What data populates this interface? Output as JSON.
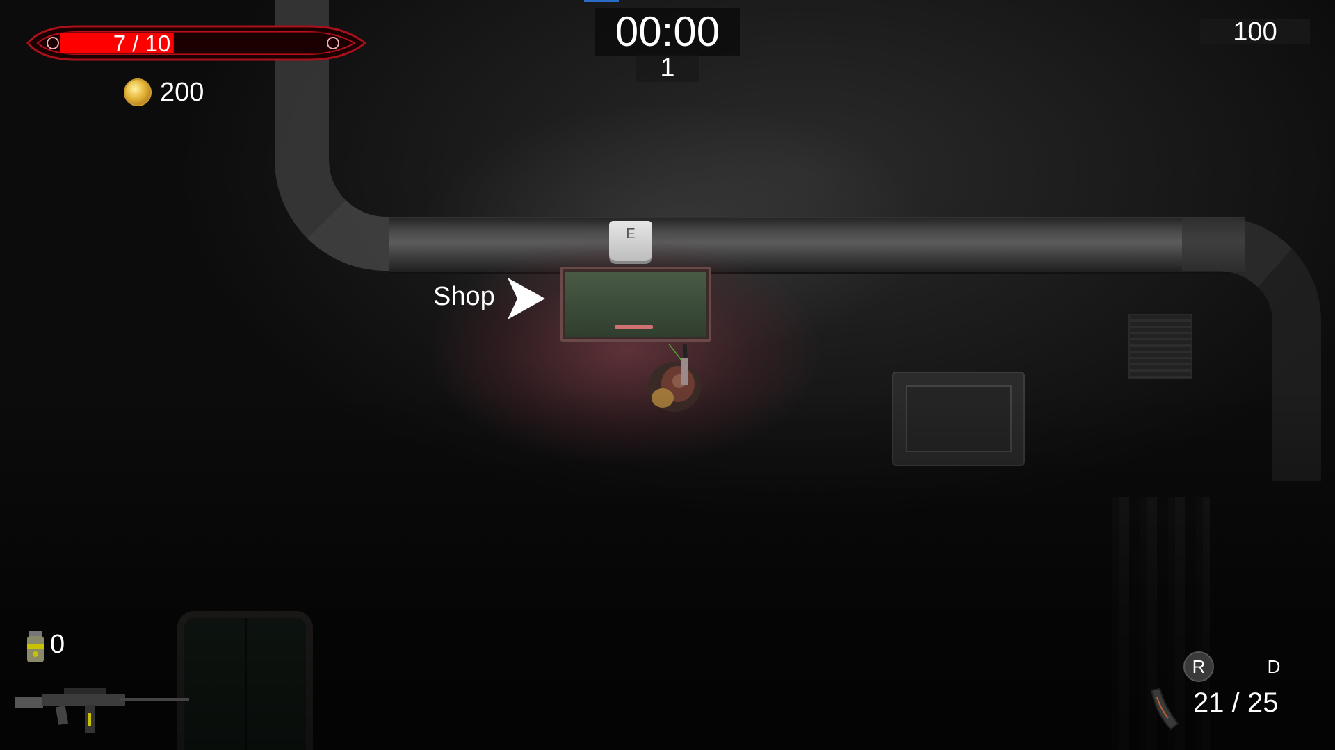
{
  "hud": {
    "health": {
      "text": "7 / 10",
      "current": 7,
      "max": 10
    },
    "coins": "200",
    "timer": "00:00",
    "wave": "1",
    "score": "100",
    "grenades": "0",
    "ammo": "21 / 25",
    "reload_key": "R",
    "drop_key": "D"
  },
  "world": {
    "shop_label": "Shop",
    "interact_key": "E"
  },
  "colors": {
    "health_fill": "#ff0000",
    "health_frame": "#a8101a",
    "accent_blue": "#2a6bc8"
  },
  "icons": {
    "coin": "coin-icon",
    "grenade": "grenade-icon",
    "weapon": "rifle-icon",
    "magazine": "magazine-icon",
    "arrow": "arrow-right-icon"
  }
}
